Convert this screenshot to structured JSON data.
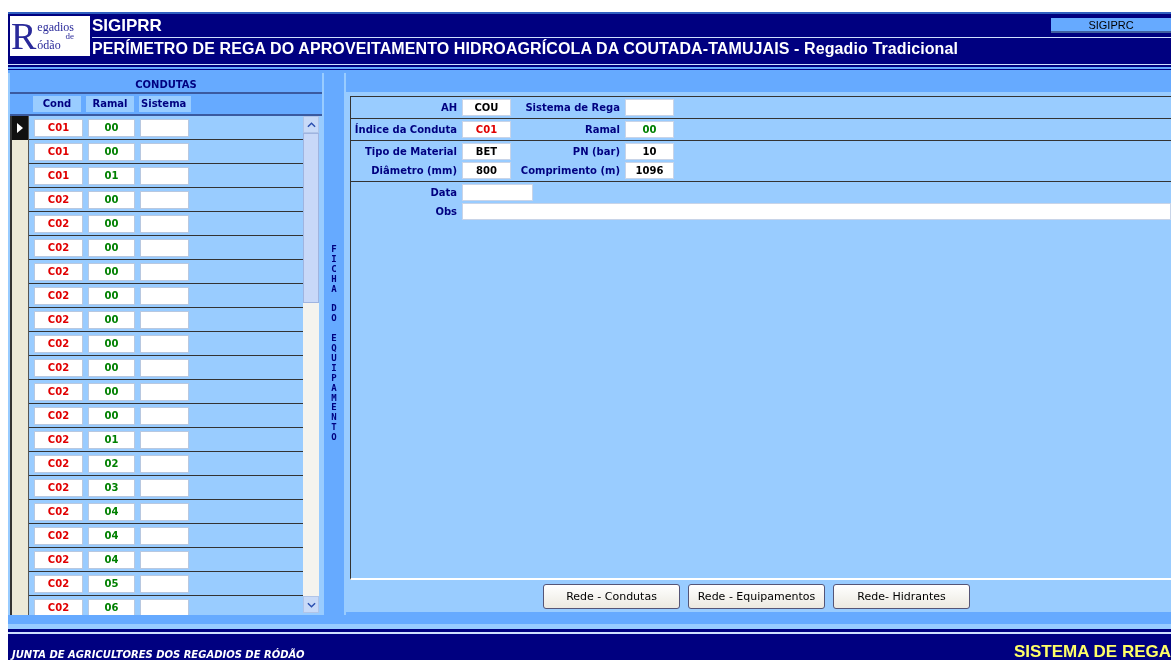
{
  "header": {
    "logo": {
      "initial": "R",
      "words": [
        "egadios",
        "de",
        "ódão"
      ]
    },
    "app_name": "SIGIPRR",
    "title": "PERÍMETRO DE REGA DO APROVEITAMENTO HIDROAGRÍCOLA DA COUTADA-TAMUJAIS - Regadio Tradicional",
    "top_button": "SIGIPRC"
  },
  "condutas": {
    "title": "CONDUTAS",
    "columns": [
      "Cond",
      "Ramal",
      "Sistema"
    ],
    "rows": [
      {
        "cond": "C01",
        "ramal": "00",
        "selected": true
      },
      {
        "cond": "C01",
        "ramal": "00",
        "selected": false
      },
      {
        "cond": "C01",
        "ramal": "01",
        "selected": false
      },
      {
        "cond": "C02",
        "ramal": "00",
        "selected": false
      },
      {
        "cond": "C02",
        "ramal": "00",
        "selected": false
      },
      {
        "cond": "C02",
        "ramal": "00",
        "selected": false
      },
      {
        "cond": "C02",
        "ramal": "00",
        "selected": false
      },
      {
        "cond": "C02",
        "ramal": "00",
        "selected": false
      },
      {
        "cond": "C02",
        "ramal": "00",
        "selected": false
      },
      {
        "cond": "C02",
        "ramal": "00",
        "selected": false
      },
      {
        "cond": "C02",
        "ramal": "00",
        "selected": false
      },
      {
        "cond": "C02",
        "ramal": "00",
        "selected": false
      },
      {
        "cond": "C02",
        "ramal": "00",
        "selected": false
      },
      {
        "cond": "C02",
        "ramal": "01",
        "selected": false
      },
      {
        "cond": "C02",
        "ramal": "02",
        "selected": false
      },
      {
        "cond": "C02",
        "ramal": "03",
        "selected": false
      },
      {
        "cond": "C02",
        "ramal": "04",
        "selected": false
      },
      {
        "cond": "C02",
        "ramal": "04",
        "selected": false
      },
      {
        "cond": "C02",
        "ramal": "04",
        "selected": false
      },
      {
        "cond": "C02",
        "ramal": "05",
        "selected": false
      },
      {
        "cond": "C02",
        "ramal": "06",
        "selected": false
      }
    ]
  },
  "side_label": "FICHA DO EQUIPAMENTO",
  "form": {
    "sections": [
      {
        "rows": [
          {
            "fields": [
              {
                "label": "AH",
                "value": "COU",
                "kind": "short",
                "color": "#000000"
              },
              {
                "label": "Sistema de Rega",
                "kind": "short"
              }
            ]
          }
        ]
      },
      {
        "rows": [
          {
            "fields": [
              {
                "label": "Índice da Conduta",
                "value": "C01",
                "kind": "short",
                "color": "#e00000"
              },
              {
                "label": "Ramal",
                "value": "00",
                "kind": "short",
                "color": "#008000"
              }
            ]
          }
        ]
      },
      {
        "rows": [
          {
            "fields": [
              {
                "label": "Tipo de Material",
                "value": "BET",
                "kind": "short",
                "color": "#000000"
              },
              {
                "label": "PN (bar)",
                "value": "10",
                "kind": "short",
                "color": "#000000"
              }
            ]
          },
          {
            "fields": [
              {
                "label": "Diâmetro (mm)",
                "value": "800",
                "kind": "short",
                "color": "#000000"
              },
              {
                "label": "Comprimento (m)",
                "value": "1096",
                "kind": "short",
                "color": "#000000"
              }
            ]
          }
        ]
      },
      {
        "rows": [
          {
            "fields": [
              {
                "label": "Data",
                "kind": "medium"
              }
            ]
          },
          {
            "fields": [
              {
                "label": "Obs",
                "kind": "wide"
              }
            ]
          }
        ]
      }
    ]
  },
  "buttons": [
    "Rede - Condutas",
    "Rede - Equipamentos",
    "Rede- Hidrantes"
  ],
  "footer": {
    "left": "JUNTA DE AGRICULTORES DOS REGADIOS DE RÓDÃO",
    "right": "SISTEMA DE REGA"
  }
}
